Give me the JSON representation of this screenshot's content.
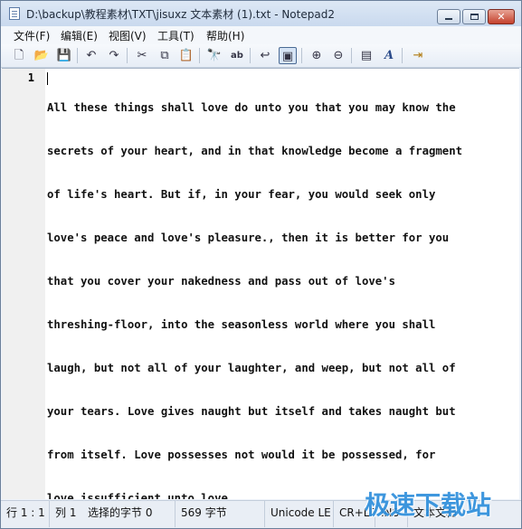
{
  "window": {
    "title": "D:\\backup\\教程素材\\TXT\\jisuxz 文本素材 (1).txt - Notepad2",
    "close_glyph": "✕"
  },
  "menu": [
    {
      "label": "文件(F)"
    },
    {
      "label": "编辑(E)"
    },
    {
      "label": "视图(V)"
    },
    {
      "label": "工具(T)"
    },
    {
      "label": "帮助(H)"
    }
  ],
  "toolbar": {
    "icons": [
      {
        "name": "new-file-icon",
        "glyph": "🗋"
      },
      {
        "name": "open-folder-icon",
        "glyph": "📂"
      },
      {
        "name": "save-icon",
        "glyph": "💾"
      },
      {
        "name": "undo-icon",
        "glyph": "↶"
      },
      {
        "name": "redo-icon",
        "glyph": "↷"
      },
      {
        "name": "cut-icon",
        "glyph": "✂"
      },
      {
        "name": "copy-icon",
        "glyph": "⧉"
      },
      {
        "name": "paste-icon",
        "glyph": "📋"
      },
      {
        "name": "find-icon",
        "glyph": "🔭"
      },
      {
        "name": "replace-icon",
        "glyph": "ab"
      },
      {
        "name": "word-wrap-icon",
        "glyph": "↩"
      },
      {
        "name": "view-toggle-icon",
        "glyph": "▣"
      },
      {
        "name": "zoom-in-icon",
        "glyph": "⊕"
      },
      {
        "name": "zoom-out-icon",
        "glyph": "⊖"
      },
      {
        "name": "scheme-icon",
        "glyph": "▤"
      },
      {
        "name": "font-icon",
        "glyph": "A"
      },
      {
        "name": "exit-icon",
        "glyph": "⇥"
      }
    ]
  },
  "editor": {
    "line_number": "1",
    "lines": [
      "All these things shall love do unto you that you may know the",
      "secrets of your heart, and in that knowledge become a fragment",
      "of life's heart. But if, in your fear, you would seek only",
      "love's peace and love's pleasure., then it is better for you",
      "that you cover your nakedness and pass out of love's",
      "threshing-floor, into the seasonless world where you shall",
      "laugh, but not all of your laughter, and weep, but not all of",
      "your tears. Love gives naught but itself and takes naught but",
      "from itself. Love possesses not would it be possessed, for",
      "love issufficient unto love."
    ]
  },
  "status": {
    "position": "行 1 : 1",
    "column": "列 1",
    "selection": "选择的字节 0",
    "size": "569 字节",
    "encoding": "Unicode LE",
    "line_ending": "CR+LF",
    "insert_mode": "INS",
    "doc_type": "文本文档"
  },
  "watermark": "极速下载站"
}
